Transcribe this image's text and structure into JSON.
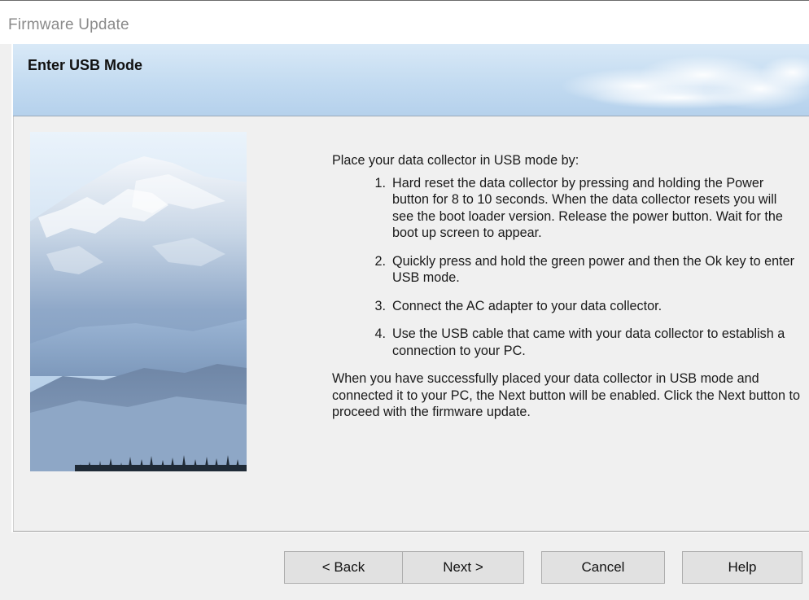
{
  "window": {
    "title": "Firmware Update"
  },
  "header": {
    "title": "Enter USB Mode"
  },
  "content": {
    "intro": "Place your data collector in USB mode by:",
    "steps": [
      {
        "num": "1.",
        "text": "Hard reset the data collector by pressing and holding the Power button for 8 to 10 seconds.  When the data collector resets you will see the boot loader version. Release the power button.  Wait for the boot up screen to appear."
      },
      {
        "num": "2.",
        "text": "Quickly press and hold the green power and then the Ok key to enter USB mode."
      },
      {
        "num": "3.",
        "text": "Connect the AC adapter to your data collector."
      },
      {
        "num": "4.",
        "text": "Use the USB cable that came with your data collector to establish a connection to your PC."
      }
    ],
    "closing": "When you have successfully placed your data collector in USB mode and connected it to your PC, the Next button will be enabled.  Click the Next button to proceed with the firmware update."
  },
  "buttons": {
    "back": "< Back",
    "next": "Next >",
    "cancel": "Cancel",
    "help": "Help"
  },
  "colors": {
    "dialog_background": "#f0f0f0",
    "header_sky": "#c3dbf1",
    "button_face": "#e1e1e1",
    "default_button_border": "#0078d7"
  }
}
